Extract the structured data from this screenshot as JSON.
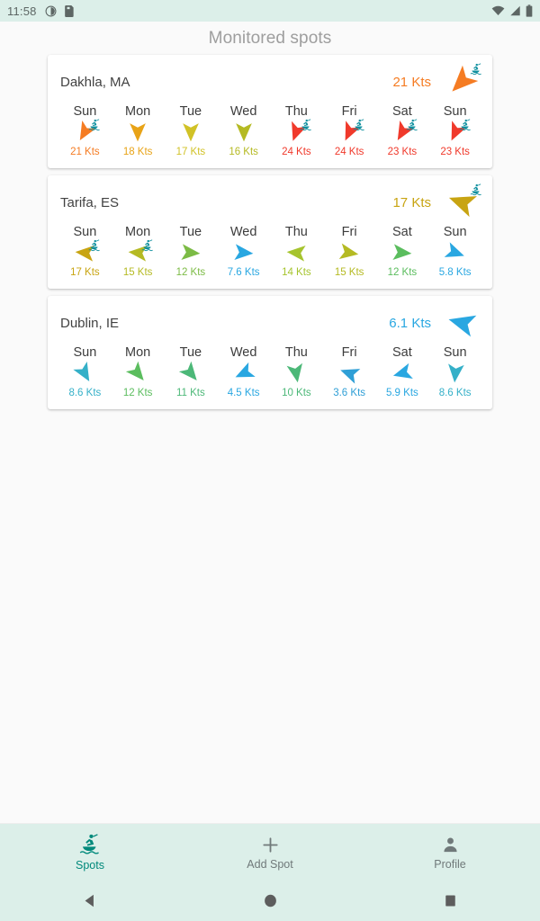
{
  "status_bar": {
    "time": "11:58",
    "icons_left": [
      "contrast-icon",
      "sim-card-icon"
    ],
    "icons_right": [
      "wifi-icon",
      "signal-icon",
      "battery-icon"
    ],
    "background": "#dcefe9"
  },
  "app_bar": {
    "title": "Monitored spots"
  },
  "colors": {
    "orange": "#f57c23",
    "amber": "#e8a317",
    "yellow": "#d1c227",
    "olive": "#b5ba23",
    "yellowgreen": "#a6c42e",
    "red": "#f0392b",
    "green": "#5bbd5e",
    "teal_green": "#4cb878",
    "blue": "#29a7e1",
    "dark_yellow": "#c8a412",
    "teal": "#00897b",
    "card_bg": "#ffffff",
    "page_bg": "#fafafa"
  },
  "spots": [
    {
      "name": "Dakhla, MA",
      "current_speed": "21 Kts",
      "current_color": "#f57c23",
      "current_dir_deg": 225,
      "current_kite": true,
      "days": [
        {
          "label": "Sun",
          "speed": "21 Kts",
          "color": "#f57c23",
          "dir_deg": 210,
          "kite": true
        },
        {
          "label": "Mon",
          "speed": "18 Kts",
          "color": "#e8a317",
          "dir_deg": 180,
          "kite": false
        },
        {
          "label": "Tue",
          "speed": "17 Kts",
          "color": "#d1c227",
          "dir_deg": 180,
          "kite": false
        },
        {
          "label": "Wed",
          "speed": "16 Kts",
          "color": "#b5ba23",
          "dir_deg": 180,
          "kite": false
        },
        {
          "label": "Thu",
          "speed": "24 Kts",
          "color": "#f0392b",
          "dir_deg": 200,
          "kite": true
        },
        {
          "label": "Fri",
          "speed": "24 Kts",
          "color": "#f0392b",
          "dir_deg": 205,
          "kite": true
        },
        {
          "label": "Sat",
          "speed": "23 Kts",
          "color": "#f0392b",
          "dir_deg": 210,
          "kite": true
        },
        {
          "label": "Sun",
          "speed": "23 Kts",
          "color": "#f0392b",
          "dir_deg": 205,
          "kite": true
        }
      ]
    },
    {
      "name": "Tarifa, ES",
      "current_speed": "17 Kts",
      "current_color": "#c8a412",
      "current_dir_deg": 290,
      "current_kite": true,
      "days": [
        {
          "label": "Sun",
          "speed": "17 Kts",
          "color": "#c8a412",
          "dir_deg": 275,
          "kite": true
        },
        {
          "label": "Mon",
          "speed": "15 Kts",
          "color": "#b5ba23",
          "dir_deg": 275,
          "kite": true
        },
        {
          "label": "Tue",
          "speed": "12 Kts",
          "color": "#7cbb45",
          "dir_deg": 95,
          "kite": false
        },
        {
          "label": "Wed",
          "speed": "7.6 Kts",
          "color": "#29a7e1",
          "dir_deg": 95,
          "kite": false
        },
        {
          "label": "Thu",
          "speed": "14 Kts",
          "color": "#a6c42e",
          "dir_deg": 275,
          "kite": false
        },
        {
          "label": "Fri",
          "speed": "15 Kts",
          "color": "#b5ba23",
          "dir_deg": 100,
          "kite": false
        },
        {
          "label": "Sat",
          "speed": "12 Kts",
          "color": "#5bbd5e",
          "dir_deg": 95,
          "kite": false
        },
        {
          "label": "Sun",
          "speed": "5.8 Kts",
          "color": "#29a7e1",
          "dir_deg": 110,
          "kite": false
        }
      ]
    },
    {
      "name": "Dublin, IE",
      "current_speed": "6.1 Kts",
      "current_color": "#29a7e1",
      "current_dir_deg": 285,
      "current_kite": false,
      "days": [
        {
          "label": "Sun",
          "speed": "8.6 Kts",
          "color": "#35b0c8",
          "dir_deg": 150,
          "kite": false
        },
        {
          "label": "Mon",
          "speed": "12 Kts",
          "color": "#5bbd5e",
          "dir_deg": 140,
          "kite": false
        },
        {
          "label": "Tue",
          "speed": "11 Kts",
          "color": "#4cb878",
          "dir_deg": 140,
          "kite": false
        },
        {
          "label": "Wed",
          "speed": "4.5 Kts",
          "color": "#29a7e1",
          "dir_deg": 245,
          "kite": false
        },
        {
          "label": "Thu",
          "speed": "10 Kts",
          "color": "#4cb878",
          "dir_deg": 170,
          "kite": false
        },
        {
          "label": "Fri",
          "speed": "3.6 Kts",
          "color": "#2f9fd6",
          "dir_deg": 290,
          "kite": false
        },
        {
          "label": "Sat",
          "speed": "5.9 Kts",
          "color": "#29a7e1",
          "dir_deg": 255,
          "kite": false
        },
        {
          "label": "Sun",
          "speed": "8.6 Kts",
          "color": "#35b0c8",
          "dir_deg": 185,
          "kite": false
        }
      ]
    }
  ],
  "bottom_nav": [
    {
      "label": "Spots",
      "icon": "kitesurfer-icon",
      "active": true
    },
    {
      "label": "Add Spot",
      "icon": "plus-icon",
      "active": false
    },
    {
      "label": "Profile",
      "icon": "person-icon",
      "active": false
    }
  ],
  "system_nav": [
    {
      "name": "back-button",
      "icon": "triangle-left-icon"
    },
    {
      "name": "home-button",
      "icon": "circle-icon"
    },
    {
      "name": "recents-button",
      "icon": "square-icon"
    }
  ]
}
